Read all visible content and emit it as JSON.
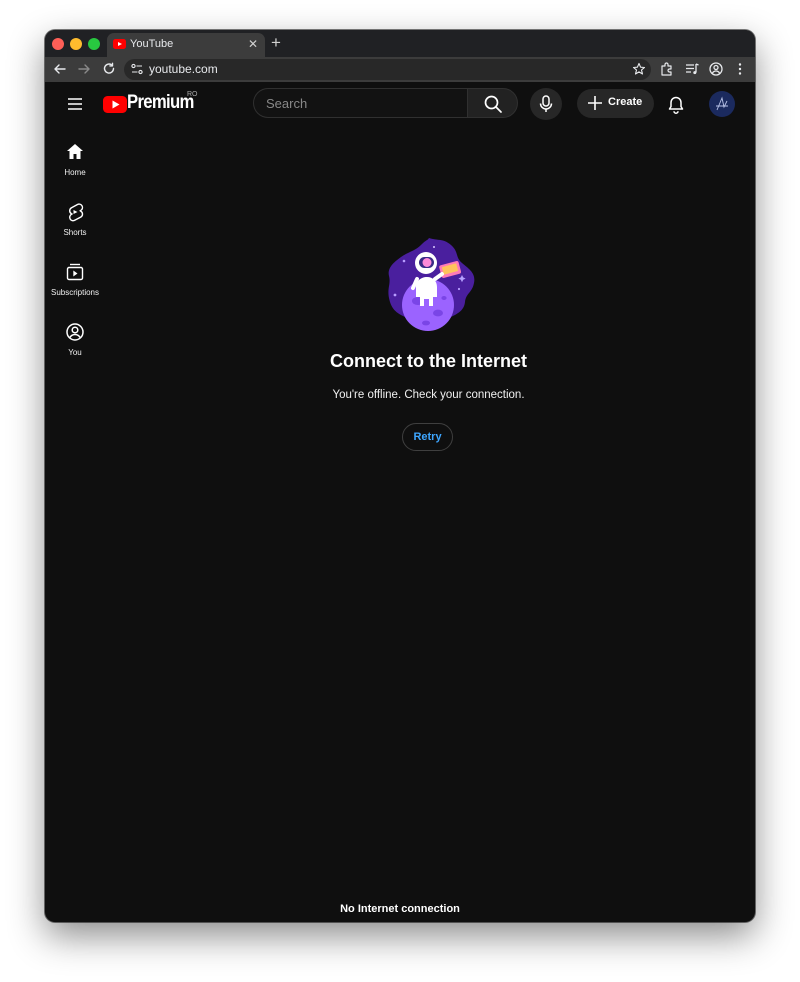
{
  "browser": {
    "tab_title": "YouTube",
    "tab_close": "✕",
    "new_tab": "+",
    "url": "youtube.com"
  },
  "masthead": {
    "logo_text": "Premium",
    "country_code": "RO",
    "search_placeholder": "Search",
    "create_label": "Create"
  },
  "sidebar": {
    "items": [
      {
        "label": "Home",
        "icon": "home-icon"
      },
      {
        "label": "Shorts",
        "icon": "shorts-icon"
      },
      {
        "label": "Subscriptions",
        "icon": "subscriptions-icon"
      },
      {
        "label": "You",
        "icon": "you-icon"
      }
    ]
  },
  "main": {
    "title": "Connect to the Internet",
    "message": "You're offline. Check your connection.",
    "retry_label": "Retry"
  },
  "status_bar": {
    "message": "No Internet connection"
  },
  "colors": {
    "background": "#0f0f0f",
    "youtube_red": "#ff0000",
    "link_blue": "#3ea6ff",
    "illustration_purple": "#6c3ad1"
  }
}
